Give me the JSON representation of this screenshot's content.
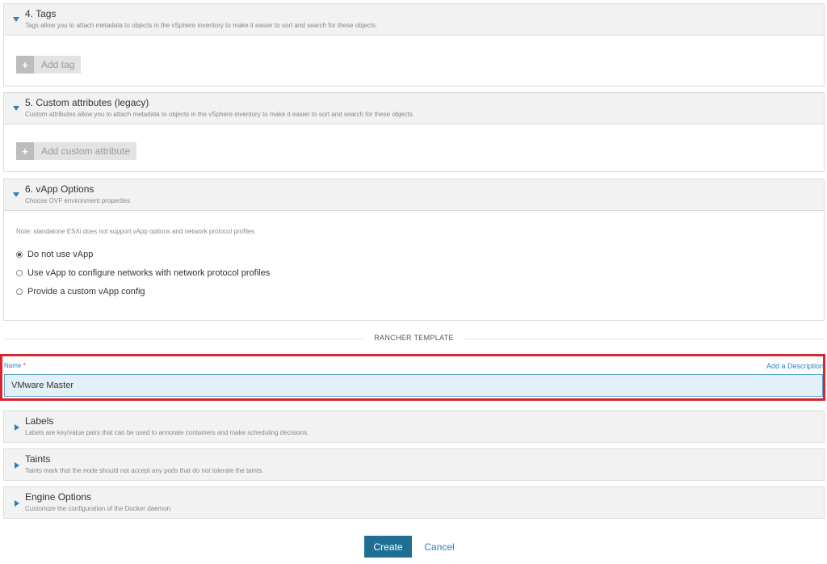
{
  "tags": {
    "title": "4. Tags",
    "description": "Tags allow you to attach metadata to objects in the vSphere inventory to make it easier to sort and search for these objects.",
    "add_label": "Add tag"
  },
  "custom_attributes": {
    "title": "5. Custom attributes (legacy)",
    "description": "Custom attributes allow you to attach metadata to objects in the vSphere inventory to make it easier to sort and search for these objects.",
    "add_label": "Add custom attribute"
  },
  "vapp": {
    "title": "6. vApp Options",
    "description": "Choose OVF environment properties",
    "note": "Note: standalone ESXi does not support vApp options and network protocol profiles",
    "options": [
      {
        "label": "Do not use vApp",
        "selected": true
      },
      {
        "label": "Use vApp to configure networks with network protocol profiles",
        "selected": false
      },
      {
        "label": "Provide a custom vApp config",
        "selected": false
      }
    ]
  },
  "template": {
    "section_label": "RANCHER TEMPLATE",
    "name_label": "Name",
    "required_mark": "*",
    "add_description": "Add a Description",
    "name_value": "VMware Master"
  },
  "sections": [
    {
      "title": "Labels",
      "description": "Labels are key/value pairs that can be used to annotate containers and make scheduling decisions."
    },
    {
      "title": "Taints",
      "description": "Taints mark that the node should not accept any pods that do not tolerate the taints."
    },
    {
      "title": "Engine Options",
      "description": "Customize the configuration of the Docker daemon"
    }
  ],
  "footer": {
    "create_label": "Create",
    "cancel_label": "Cancel"
  },
  "colors": {
    "accent": "#2c7fb8",
    "primary_button": "#1f6f94",
    "highlight_border": "#d9232d",
    "input_bg": "#e4f0f7"
  }
}
